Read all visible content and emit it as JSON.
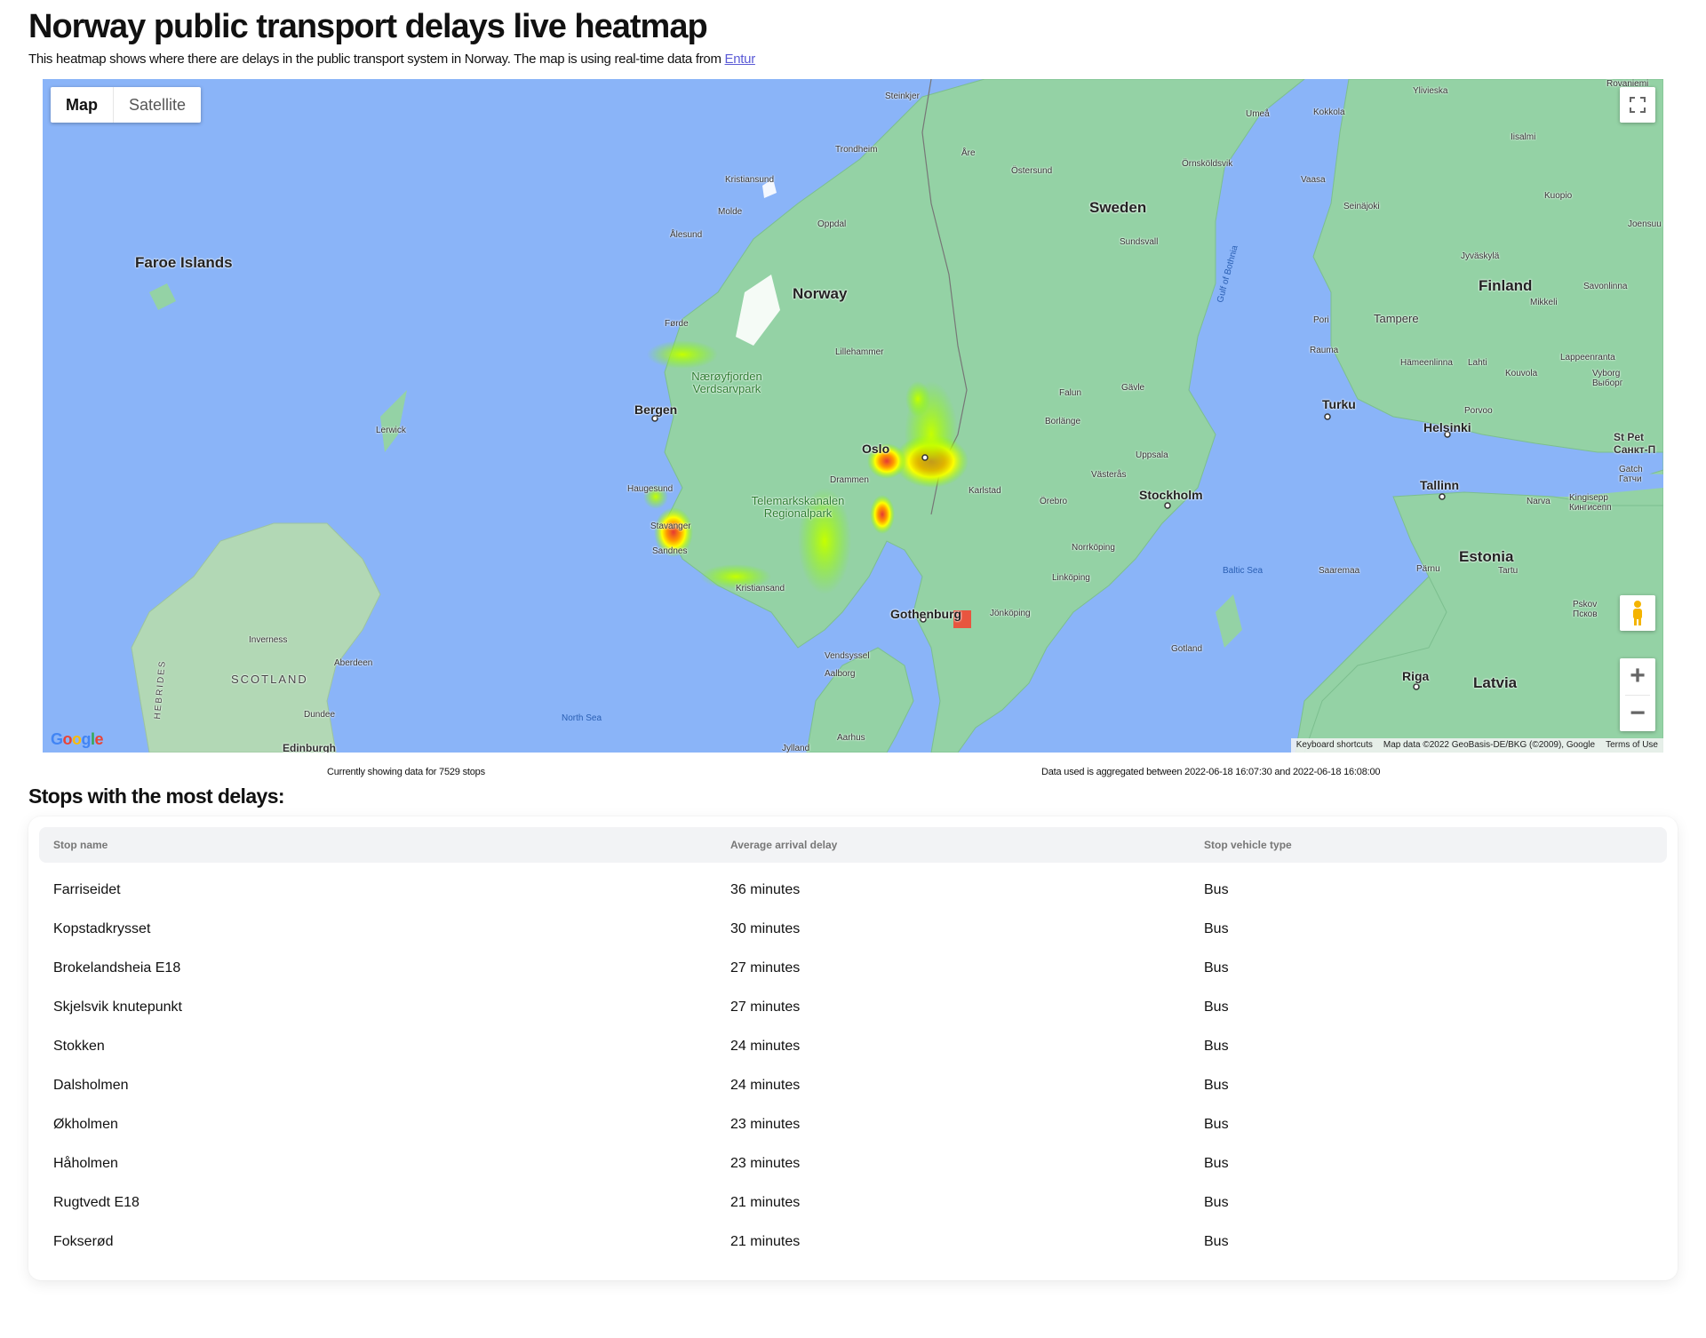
{
  "page": {
    "title": "Norway public transport delays live heatmap",
    "intro_text": "This heatmap shows where there are delays in the public transport system in Norway. The map is using real-time data from",
    "intro_link": "Entur"
  },
  "map": {
    "type_controls": {
      "map_label": "Map",
      "satellite_label": "Satellite",
      "selected": "Map"
    },
    "zoom_in_label": "+",
    "zoom_out_label": "−",
    "logo_text": "Google",
    "attribution": {
      "shortcuts": "Keyboard shortcuts",
      "data": "Map data ©2022 GeoBasis-DE/BKG (©2009), Google",
      "terms": "Terms of Use"
    },
    "labels": {
      "faroe": "Faroe Islands",
      "norway": "Norway",
      "sweden": "Sweden",
      "finland": "Finland",
      "estonia": "Estonia",
      "latvia": "Latvia",
      "scotland": "SCOTLAND",
      "hebrides": "HEBRIDES",
      "bergen": "Bergen",
      "oslo": "Oslo",
      "stockholm": "Stockholm",
      "gothenburg": "Gothenburg",
      "helsinki": "Helsinki",
      "tallinn": "Tallinn",
      "riga": "Riga",
      "turku": "Turku",
      "tampere": "Tampere",
      "trondheim": "Trondheim",
      "kristiansand": "Kristiansand",
      "kristiansund": "Kristiansund",
      "molde": "Molde",
      "alesund": "Ålesund",
      "oppdal": "Oppdal",
      "forde": "Førde",
      "lillehammer": "Lillehammer",
      "drammen": "Drammen",
      "haugesund": "Haugesund",
      "stavanger": "Stavanger",
      "sandnes": "Sandnes",
      "lerwick": "Lerwick",
      "inverness": "Inverness",
      "aberdeen": "Aberdeen",
      "dundee": "Dundee",
      "edinburgh": "Edinburgh",
      "north_sea": "North Sea",
      "baltic_sea": "Baltic Sea",
      "gulf_bothnia": "Gulf of Bothnia",
      "park1": "Nærøyfjorden Verdsarvpark",
      "park2": "Telemarkskanalen Regionalpark",
      "steinkjer": "Steinkjer",
      "are": "Åre",
      "ostersund": "Östersund",
      "sundsvall": "Sundsvall",
      "umea": "Umeå",
      "ornskoldsvik": "Örnsköldsvik",
      "falun": "Falun",
      "borlange": "Borlänge",
      "gavle": "Gävle",
      "uppsala": "Uppsala",
      "vasteras": "Västerås",
      "karlstad": "Karlstad",
      "orebro": "Örebro",
      "norrkoping": "Norrköping",
      "linkoping": "Linköping",
      "jonkoping": "Jönköping",
      "gotland": "Gotland",
      "vendsyssel": "Vendsyssel",
      "aalborg": "Aalborg",
      "aarhus": "Aarhus",
      "jylland": "Jylland",
      "vaasa": "Vaasa",
      "seinajoki": "Seinäjoki",
      "kuopio": "Kuopio",
      "joensuu": "Joensuu",
      "jyvaskyla": "Jyväskylä",
      "savonlinna": "Savonlinna",
      "mikkeli": "Mikkeli",
      "pori": "Pori",
      "rauma": "Rauma",
      "hameenlinna": "Hämeenlinna",
      "lahti": "Lahti",
      "kouvola": "Kouvola",
      "lappeenranta": "Lappeenranta",
      "vyborg": "Vyborg Выборг",
      "porvoo": "Porvoo",
      "stpete": "St Pet Санкт-П",
      "gatchina": "Gatch Гатчи",
      "kingisepp": "Kingisepp Кингисепп",
      "narva": "Narva",
      "parnu": "Pärnu",
      "tartu": "Tartu",
      "saaremaa": "Saaremaa",
      "pskov": "Pskov Псков",
      "kokkola": "Kokkola",
      "ylivieska": "Ylivieska",
      "iisalmi": "Iisalmi",
      "rovaniemi": "Rovaniemi"
    }
  },
  "meta": {
    "stops_count_text": "Currently showing data for 7529 stops",
    "aggregation_text": "Data used is aggregated between 2022-06-18 16:07:30 and 2022-06-18 16:08:00"
  },
  "table": {
    "heading": "Stops with the most delays:",
    "columns": [
      "Stop name",
      "Average arrival delay",
      "Stop vehicle type"
    ],
    "rows": [
      [
        "Farriseidet",
        "36 minutes",
        "Bus"
      ],
      [
        "Kopstadkrysset",
        "30 minutes",
        "Bus"
      ],
      [
        "Brokelandsheia E18",
        "27 minutes",
        "Bus"
      ],
      [
        "Skjelsvik knutepunkt",
        "27 minutes",
        "Bus"
      ],
      [
        "Stokken",
        "24 minutes",
        "Bus"
      ],
      [
        "Dalsholmen",
        "24 minutes",
        "Bus"
      ],
      [
        "Økholmen",
        "23 minutes",
        "Bus"
      ],
      [
        "Håholmen",
        "23 minutes",
        "Bus"
      ],
      [
        "Rugtvedt E18",
        "21 minutes",
        "Bus"
      ],
      [
        "Fokserød",
        "21 minutes",
        "Bus"
      ]
    ]
  },
  "colors": {
    "water": "#8ab4f8",
    "land": "#94d2a5",
    "heat_low": "#7cfc00",
    "heat_mid": "#ffff00",
    "heat_high": "#e53935"
  }
}
